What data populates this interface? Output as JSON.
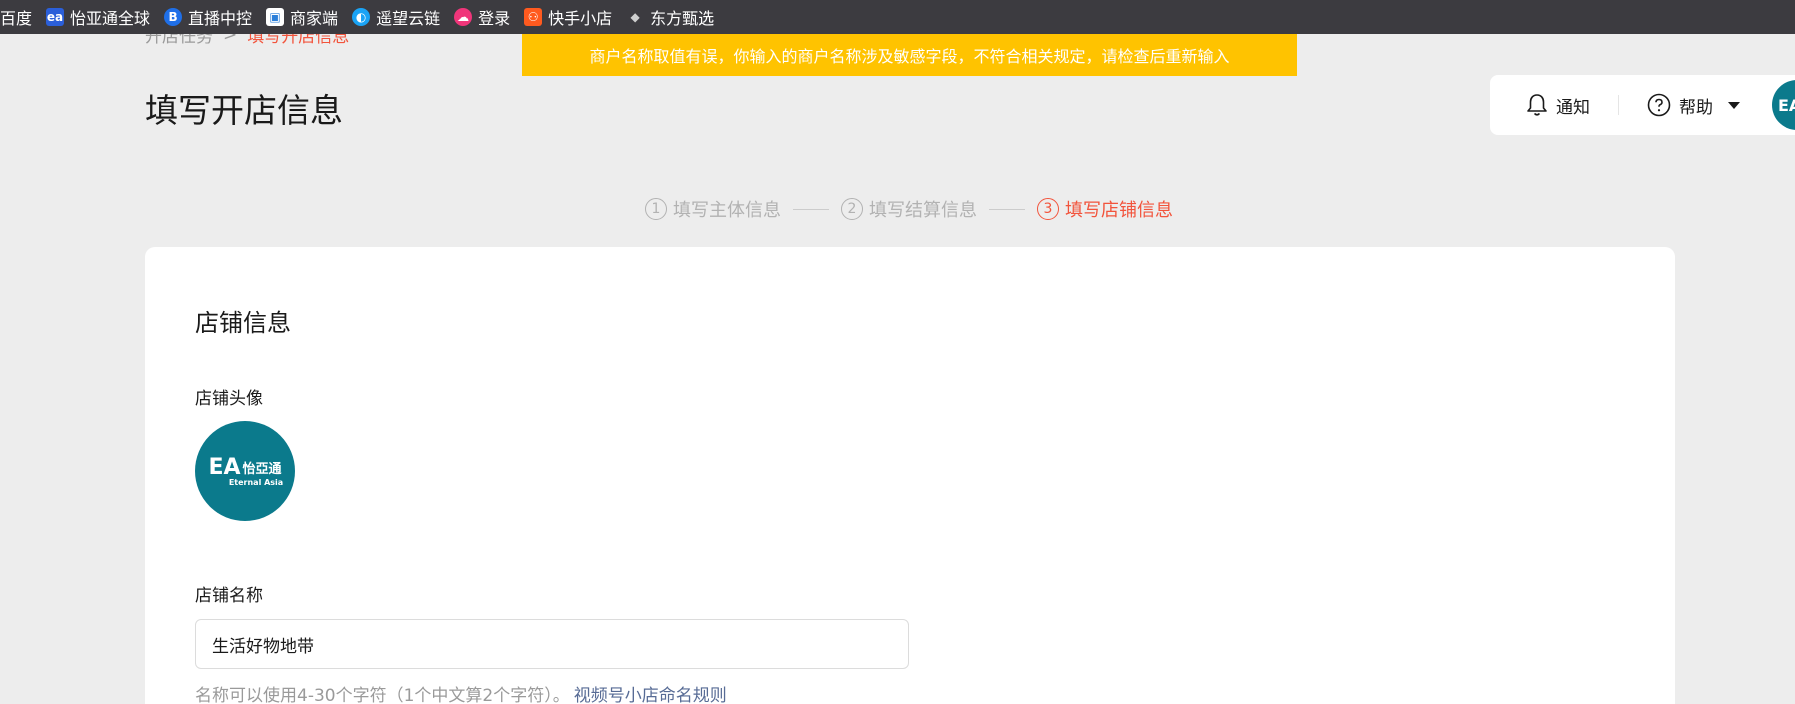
{
  "bookmarks": [
    {
      "label": "百度",
      "icon": "baidu-icon",
      "color": "#3c3b40"
    },
    {
      "label": "怡亚通全球",
      "icon": "eternal-asia-icon",
      "color": "#2b5fd9"
    },
    {
      "label": "直播中控",
      "icon": "bilibili-b-icon",
      "color": "#1f6fe8"
    },
    {
      "label": "商家端",
      "icon": "shop-icon",
      "color": "#ffffff"
    },
    {
      "label": "遥望云链",
      "icon": "yaowang-icon",
      "color": "#1aa3f5"
    },
    {
      "label": "登录",
      "icon": "login-icon",
      "color": "#f0357a"
    },
    {
      "label": "快手小店",
      "icon": "kuaishou-icon",
      "color": "#ff5a1f"
    },
    {
      "label": "东方甄选",
      "icon": "dongfang-icon",
      "color": "#555555"
    }
  ],
  "breadcrumb": {
    "parent": "开店任务",
    "separator": ">",
    "current": "填写开店信息"
  },
  "toast": {
    "message": "商户名称取值有误，你输入的商户名称涉及敏感字段，不符合相关规定，请检查后重新输入"
  },
  "page": {
    "title": "填写开店信息"
  },
  "header": {
    "notify_label": "通知",
    "help_label": "帮助",
    "avatar_text": "EA"
  },
  "steps": [
    {
      "num": "1",
      "label": "填写主体信息",
      "active": false
    },
    {
      "num": "2",
      "label": "填写结算信息",
      "active": false
    },
    {
      "num": "3",
      "label": "填写店铺信息",
      "active": true
    }
  ],
  "form": {
    "section_title": "店铺信息",
    "avatar_label": "店铺头像",
    "avatar_logo": {
      "mark": "EA",
      "cn": "怡亞通",
      "en": "Eternal Asia"
    },
    "name_label": "店铺名称",
    "name_value": "生活好物地带",
    "name_hint": "名称可以使用4-30个字符（1个中文算2个字符）。",
    "name_rule_link": "视频号小店命名规则"
  },
  "colors": {
    "accent": "#f2543c",
    "toast": "#ffc300",
    "link": "#576b95",
    "brand_teal": "#0b7a8c"
  }
}
